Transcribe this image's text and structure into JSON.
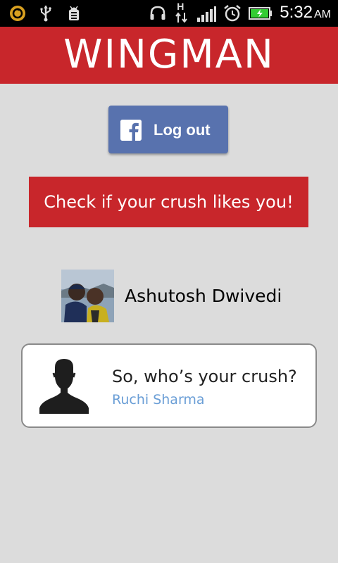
{
  "status_bar": {
    "time": "5:32",
    "ampm": "AM",
    "network_label": "H",
    "icons": [
      "sync-icon",
      "usb-icon",
      "debug-icon",
      "headphones-icon",
      "data-transfer-icon",
      "signal-icon",
      "alarm-icon",
      "battery-charging-icon"
    ],
    "battery_color": "#33cc33"
  },
  "header": {
    "title": "WINGMAN",
    "color": "#c8262b"
  },
  "facebook_button": {
    "label": "Log out",
    "color": "#5872ae",
    "icon": "facebook-icon"
  },
  "check_button": {
    "label": "Check if your crush likes you!",
    "color": "#c8262b"
  },
  "user": {
    "name": "Ashutosh Dwivedi",
    "avatar": "profile-photo"
  },
  "crush_card": {
    "prompt": "So, who’s your crush?",
    "crush_name": "Ruchi Sharma",
    "crush_name_color": "#6a9ed6",
    "icon": "person-silhouette-icon"
  }
}
